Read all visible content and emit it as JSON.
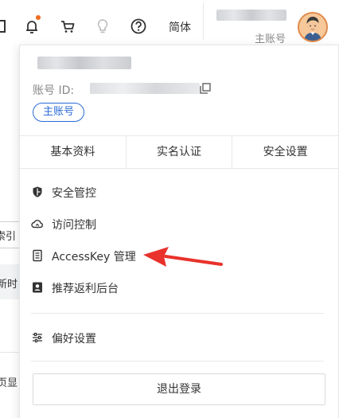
{
  "header": {
    "language_label": "简体",
    "account_type": "主账号",
    "icons": [
      "window-icon",
      "bell-icon",
      "cart-icon",
      "lightbulb-icon",
      "help-icon"
    ],
    "notification_dot_color": "#f26b1d"
  },
  "left_fragments": {
    "index_label": "索引",
    "new_time_label": "新时",
    "page_display_label": "页显"
  },
  "account_panel": {
    "account_id_label": "账号 ID:",
    "account_badge": "主账号",
    "tabs": [
      {
        "label": "基本资料"
      },
      {
        "label": "实名认证"
      },
      {
        "label": "安全设置"
      }
    ],
    "menu": [
      {
        "label": "安全管控",
        "icon": "shield-icon"
      },
      {
        "label": "访问控制",
        "icon": "cloud-icon"
      },
      {
        "label": "AccessKey 管理",
        "icon": "key-icon"
      },
      {
        "label": "推荐返利后台",
        "icon": "profile-card-icon"
      },
      {
        "label": "偏好设置",
        "icon": "sliders-icon"
      }
    ],
    "logout_label": "退出登录"
  },
  "colors": {
    "accent_blue": "#2a6ad6",
    "annotation_arrow": "#e8322b"
  }
}
